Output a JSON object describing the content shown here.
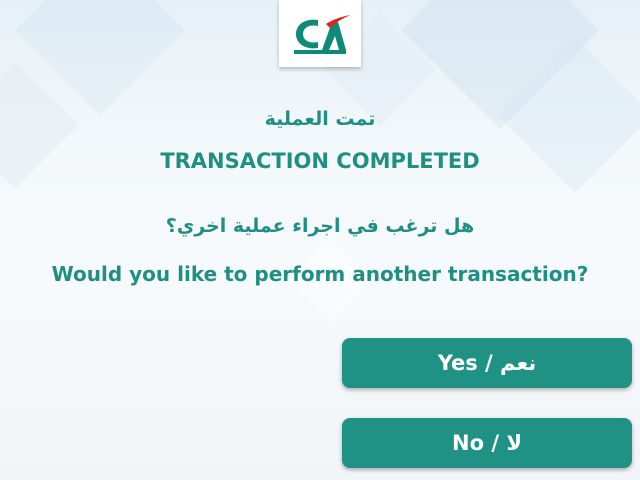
{
  "logo": {
    "name": "credit-agricole-logo",
    "color_green": "#0f8a78",
    "color_red": "#e2231a"
  },
  "screen": {
    "title_ar": "تمت العملية",
    "title_en": "TRANSACTION COMPLETED",
    "question_ar": "هل ترغب في اجراء عملية اخري؟",
    "question_en": "Would you like to perform another transaction?"
  },
  "buttons": {
    "yes_label": "Yes / نعم",
    "no_label": "No / لا"
  },
  "colors": {
    "accent": "#1f8f84",
    "button_bg": "#1f9185",
    "button_text": "#ffffff"
  }
}
